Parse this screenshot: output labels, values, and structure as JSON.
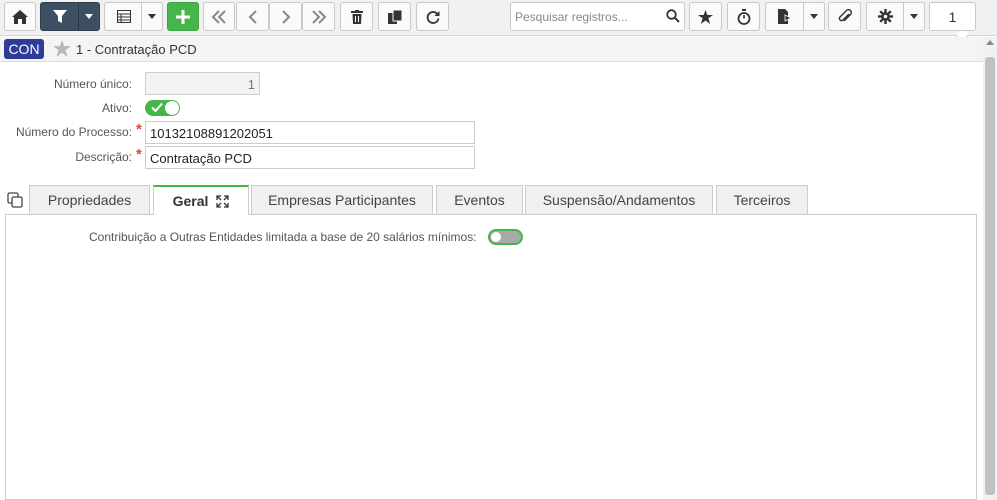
{
  "toolbar": {
    "search_placeholder": "Pesquisar registros...",
    "page_number": "1"
  },
  "header": {
    "badge": "CON",
    "title": "1 - Contratação PCD"
  },
  "form": {
    "numero_unico": {
      "label": "Número único:",
      "value": "1"
    },
    "ativo": {
      "label": "Ativo:",
      "value": true
    },
    "numero_processo": {
      "label": "Número do Processo:",
      "value": "10132108891202051"
    },
    "descricao": {
      "label": "Descrição:",
      "value": "Contratação PCD"
    }
  },
  "tabs": [
    {
      "label": "Propriedades"
    },
    {
      "label": "Geral"
    },
    {
      "label": "Empresas Participantes"
    },
    {
      "label": "Eventos"
    },
    {
      "label": "Suspensão/Andamentos"
    },
    {
      "label": "Terceiros"
    }
  ],
  "active_tab": "Geral",
  "panel": {
    "contribuicao_label": "Contribuição a Outras Entidades limitada a base de 20 salários mínimos:",
    "contribuicao_value": false
  },
  "colors": {
    "accent_green": "#45b649",
    "badge_blue": "#2e3b97",
    "dark_button": "#3d4f62",
    "required": "#d9473c"
  }
}
